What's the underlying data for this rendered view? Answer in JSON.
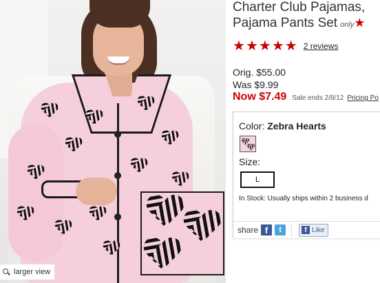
{
  "product": {
    "title_line1": "Charter Club Pajamas,",
    "title_line2": "Pajama Pants Set",
    "only_badge": "only",
    "only_star": "★",
    "image_alt": "pink zebra hearts pajama set"
  },
  "rating": {
    "stars": 5,
    "star_glyph": "★",
    "reviews_label": "2 reviews"
  },
  "price": {
    "orig": "Orig. $55.00",
    "was": "Was $9.99",
    "now": "Now $7.49",
    "sale_ends": "Sale ends 2/8/12",
    "pricing_policy": "Pricing Po"
  },
  "options": {
    "color_label": "Color:",
    "color_value": "Zebra Hearts",
    "size_label": "Size:",
    "size_value": "L",
    "stock_text": "In Stock: Usually ships within 2 business d"
  },
  "share": {
    "label": "share",
    "facebook_glyph": "f",
    "twitter_glyph": "t",
    "like_glyph": "f",
    "like_label": "Like"
  },
  "image_controls": {
    "larger_view": "larger view"
  },
  "colors": {
    "accent_red": "#cc0000",
    "pajama_pink": "#f6cfdc",
    "facebook_blue": "#3b5998",
    "twitter_blue": "#4aa3df"
  }
}
